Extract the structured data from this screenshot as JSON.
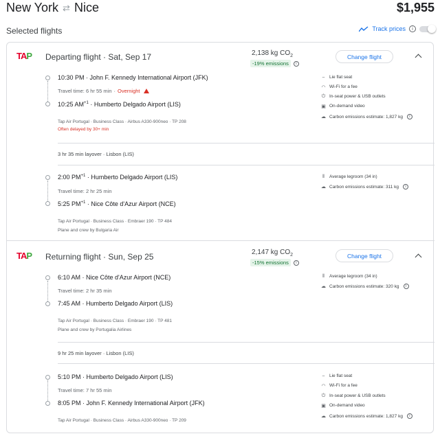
{
  "header": {
    "origin": "New York",
    "swap_icon": "⇄",
    "destination": "Nice",
    "price": "$1,955"
  },
  "selected_label": "Selected flights",
  "track": {
    "label": "Track prices",
    "info": "i"
  },
  "departing": {
    "title": "Departing flight · Sat, Sep 17",
    "co2": "2,138 kg CO",
    "co2_sub": "2",
    "emissions": "-19% emissions",
    "change_label": "Change flight",
    "segments": [
      {
        "dep_time": "10:30 PM",
        "dep_plus": "",
        "dep_airport": " · John F. Kennedy International Airport (JFK)",
        "travel": "Travel time: 6 hr 55 min",
        "overnight": "Overnight",
        "arr_time": "10:25 AM",
        "arr_plus": "+1",
        "arr_airport": " · Humberto Delgado Airport (LIS)",
        "meta": "Tap Air Portugal · Business Class · Airbus A330-900neo · TP 208",
        "note": "Often delayed by 30+ min",
        "amenities": [
          "Lie flat seat",
          "Wi-Fi for a fee",
          "In-seat power & USB outlets",
          "On-demand video",
          "Carbon emissions estimate: 1,827 kg"
        ]
      },
      {
        "dep_time": "2:00 PM",
        "dep_plus": "+1",
        "dep_airport": " · Humberto Delgado Airport (LIS)",
        "travel": "Travel time: 2 hr 25 min",
        "arr_time": "5:25 PM",
        "arr_plus": "+1",
        "arr_airport": " · Nice Côte d'Azur Airport (NCE)",
        "meta": "Tap Air Portugal · Business Class · Embraer 190 · TP 484",
        "note": "Plane and crew by Bulgaria Air",
        "amenities": [
          "Average legroom (34 in)",
          "Carbon emissions estimate: 311 kg"
        ]
      }
    ],
    "layover": "3 hr 35 min layover · Lisbon (LIS)"
  },
  "returning": {
    "title": "Returning flight · Sun, Sep 25",
    "co2": "2,147 kg CO",
    "co2_sub": "2",
    "emissions": "-15% emissions",
    "change_label": "Change flight",
    "segments": [
      {
        "dep_time": "6:10 AM",
        "dep_plus": "",
        "dep_airport": " · Nice Côte d'Azur Airport (NCE)",
        "travel": "Travel time: 2 hr 35 min",
        "arr_time": "7:45 AM",
        "arr_plus": "",
        "arr_airport": " · Humberto Delgado Airport (LIS)",
        "meta": "Tap Air Portugal · Business Class · Embraer 190 · TP 481",
        "note": "Plane and crew by Portugalia Airlines",
        "amenities": [
          "Average legroom (34 in)",
          "Carbon emissions estimate: 320 kg"
        ]
      },
      {
        "dep_time": "5:10 PM",
        "dep_plus": "",
        "dep_airport": " · Humberto Delgado Airport (LIS)",
        "travel": "Travel time: 7 hr 55 min",
        "arr_time": "8:05 PM",
        "arr_plus": "",
        "arr_airport": " · John F. Kennedy International Airport (JFK)",
        "meta": "Tap Air Portugal · Business Class · Airbus A330-900neo · TP 209",
        "note": "",
        "amenities": [
          "Lie flat seat",
          "Wi-Fi for a fee",
          "In-seat power & USB outlets",
          "On-demand video",
          "Carbon emissions estimate: 1,827 kg"
        ]
      }
    ],
    "layover": "9 hr 25 min layover · Lisbon (LIS)"
  },
  "airline_logo": "TAP",
  "colors": {
    "accent": "#1a73e8",
    "green": "#137333",
    "warn": "#d93025",
    "tap_red": "#e4002b",
    "tap_green": "#3ea83f"
  }
}
